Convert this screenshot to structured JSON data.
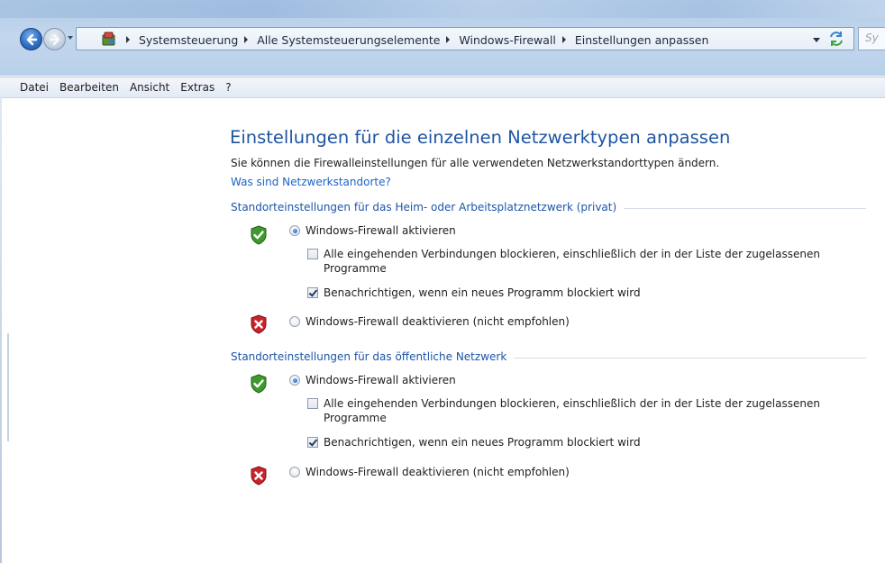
{
  "address_bar": {
    "breadcrumbs": [
      "Systemsteuerung",
      "Alle Systemsteuerungselemente",
      "Windows-Firewall",
      "Einstellungen anpassen"
    ],
    "search_placeholder": "Sy"
  },
  "menu": {
    "items": [
      "Datei",
      "Bearbeiten",
      "Ansicht",
      "Extras",
      "?"
    ]
  },
  "main": {
    "title": "Einstellungen für die einzelnen Netzwerktypen anpassen",
    "description": "Sie können die Firewalleinstellungen für alle verwendeten Netzwerkstandorttypen ändern.",
    "help_link": "Was sind Netzwerkstandorte?",
    "groups": [
      {
        "header": "Standorteinstellungen für das Heim- oder Arbeitsplatznetzwerk (privat)",
        "enable_label": "Windows-Firewall aktivieren",
        "enable_selected": true,
        "block_all_label": "Alle eingehenden Verbindungen blockieren, einschließlich der in der Liste der zugelassenen Programme",
        "block_all_checked": false,
        "notify_label": "Benachrichtigen, wenn ein neues Programm blockiert wird",
        "notify_checked": true,
        "disable_label": "Windows-Firewall deaktivieren (nicht empfohlen)",
        "disable_selected": false
      },
      {
        "header": "Standorteinstellungen für das öffentliche Netzwerk",
        "enable_label": "Windows-Firewall aktivieren",
        "enable_selected": true,
        "block_all_label": "Alle eingehenden Verbindungen blockieren, einschließlich der in der Liste der zugelassenen Programme",
        "block_all_checked": false,
        "notify_label": "Benachrichtigen, wenn ein neues Programm blockiert wird",
        "notify_checked": true,
        "disable_label": "Windows-Firewall deaktivieren (nicht empfohlen)",
        "disable_selected": false
      }
    ]
  },
  "icons": {
    "shield_ok": "green-shield-check-icon",
    "shield_off": "red-shield-x-icon"
  },
  "colors": {
    "title_blue": "#1f55a3",
    "link_blue": "#1c64c7",
    "shield_green": "#3f9a2e",
    "shield_red": "#c8242b"
  }
}
